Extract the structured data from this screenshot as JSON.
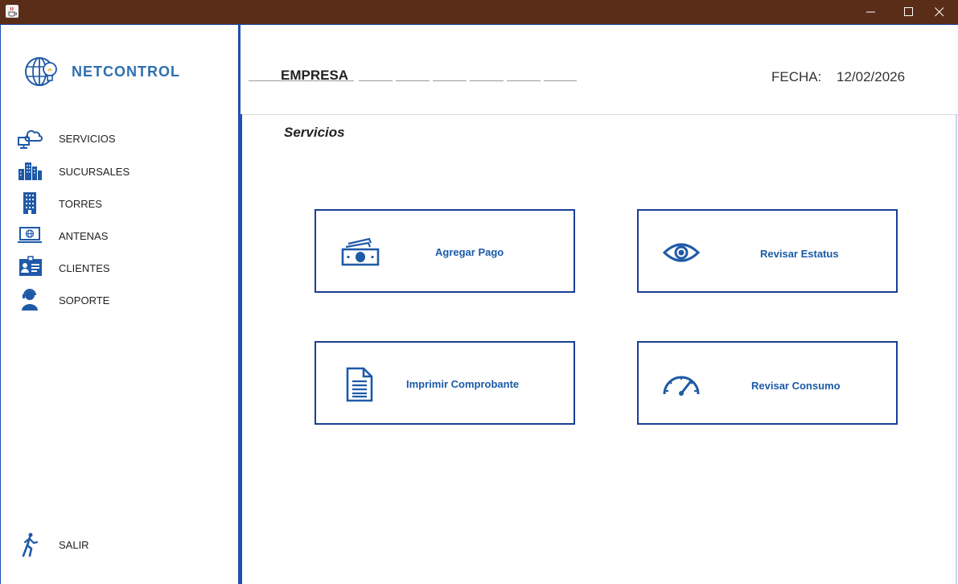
{
  "window": {
    "icons": {
      "app": "java-cup-icon",
      "minimize": "minimize-icon",
      "maximize": "maximize-icon",
      "close": "close-icon"
    }
  },
  "brand": {
    "name": "NETCONTROL",
    "color": "#2e6fb0",
    "icon": "globe-lightbulb-icon"
  },
  "sidebar": {
    "accent": "#1f4fb0",
    "items": [
      {
        "label": "SERVICIOS",
        "icon": "cloud-computer-icon"
      },
      {
        "label": "SUCURSALES",
        "icon": "city-buildings-icon"
      },
      {
        "label": "TORRES",
        "icon": "tower-building-icon"
      },
      {
        "label": "ANTENAS",
        "icon": "laptop-globe-icon"
      },
      {
        "label": "CLIENTES",
        "icon": "id-card-icon"
      },
      {
        "label": "SOPORTE",
        "icon": "support-agent-icon"
      }
    ],
    "exit": {
      "label": "SALIR",
      "icon": "walking-person-icon"
    }
  },
  "header": {
    "company_label": "EMPRESA",
    "date_label": "FECHA:",
    "date_value": "12/02/2026"
  },
  "main": {
    "section_title": "Servicios",
    "card_color": "#1a3e96",
    "cards": [
      {
        "label": "Agregar Pago",
        "icon": "money-bills-icon"
      },
      {
        "label": "Revisar Estatus",
        "icon": "eye-icon"
      },
      {
        "label": "Imprimir Comprobante",
        "icon": "document-icon"
      },
      {
        "label": "Revisar Consumo",
        "icon": "speedometer-icon"
      }
    ]
  }
}
